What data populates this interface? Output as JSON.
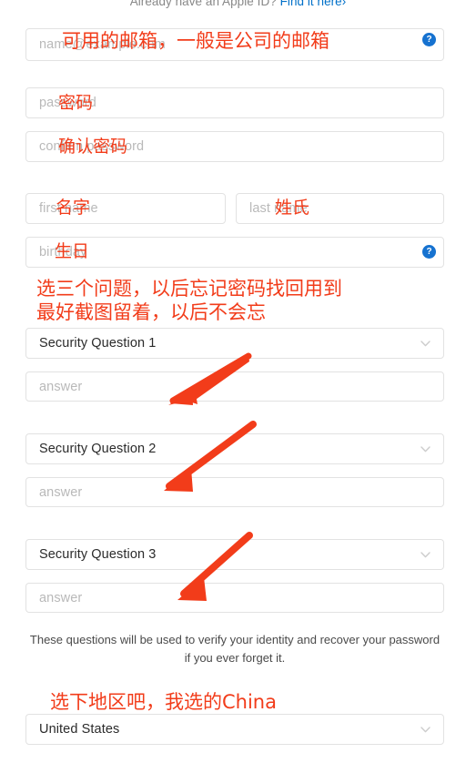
{
  "header": {
    "prompt_text": "Already have an Apple ID? ",
    "link_text": "Find it here›"
  },
  "form": {
    "email": {
      "placeholder": "name@example.com",
      "value": "",
      "help_icon": "?"
    },
    "password": {
      "placeholder": "password",
      "value": ""
    },
    "confirm_password": {
      "placeholder": "confirm password",
      "value": ""
    },
    "first_name": {
      "placeholder": "first name",
      "value": ""
    },
    "last_name": {
      "placeholder": "last name",
      "value": ""
    },
    "birthday": {
      "placeholder": "birthday",
      "value": "",
      "help_icon": "?"
    },
    "security_questions": [
      {
        "select_label": "Security Question 1",
        "answer_placeholder": "answer",
        "answer_value": ""
      },
      {
        "select_label": "Security Question 2",
        "answer_placeholder": "answer",
        "answer_value": ""
      },
      {
        "select_label": "Security Question 3",
        "answer_placeholder": "answer",
        "answer_value": ""
      }
    ],
    "questions_note": "These questions will be used to verify your identity and recover your password if you ever forget it.",
    "country": {
      "selected": "United States"
    }
  },
  "annotations": {
    "email_note": "可用的邮箱，一般是公司的邮箱",
    "password_note": "密码",
    "confirm_password_note": "确认密码",
    "first_name_note": "名字",
    "last_name_note": "姓氏",
    "birthday_note": "生日",
    "security_note_line1": "选三个问题，以后忘记密码找回用到",
    "security_note_line2": "最好截图留着，以后不会忘",
    "country_note": "选下地区吧，我选的China"
  },
  "colors": {
    "annotation_red": "#f23c1a",
    "link_blue": "#0070c9",
    "help_blue": "#1672d0",
    "field_border": "#e2e2e2",
    "placeholder_gray": "#b9b9b9"
  }
}
